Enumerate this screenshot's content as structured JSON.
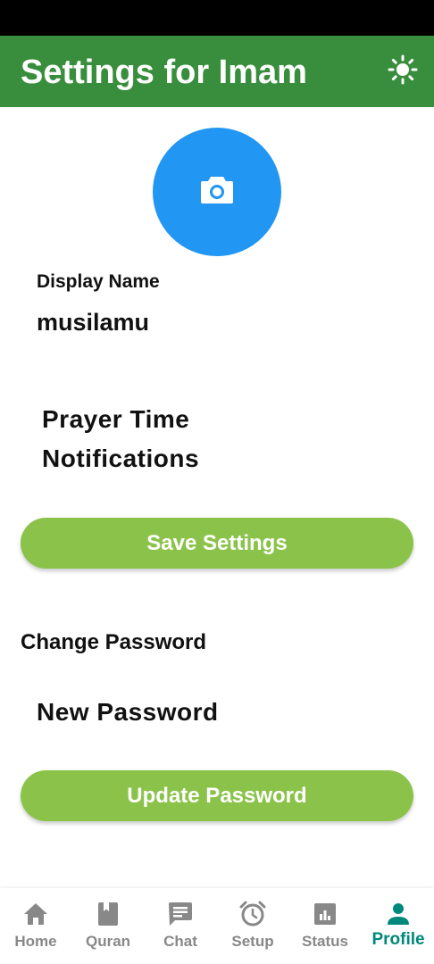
{
  "app_bar": {
    "title": "Settings for Imam",
    "theme_icon": "sun-icon"
  },
  "profile": {
    "avatar_icon": "camera-icon",
    "avatar_color": "#2196f3",
    "display_name_label": "Display Name",
    "display_name_value": "musilamu"
  },
  "notifications": {
    "label": "Prayer Time Notifications"
  },
  "buttons": {
    "save_label": "Save Settings",
    "update_password_label": "Update Password"
  },
  "password": {
    "section_title": "Change Password",
    "new_password_label": "New Password"
  },
  "bottom_nav": {
    "items": [
      {
        "label": "Home",
        "icon": "home-icon"
      },
      {
        "label": "Quran",
        "icon": "book-icon"
      },
      {
        "label": "Chat",
        "icon": "chat-icon"
      },
      {
        "label": "Setup",
        "icon": "alarm-icon"
      },
      {
        "label": "Status",
        "icon": "chart-icon"
      },
      {
        "label": "Profile",
        "icon": "person-icon",
        "active": true
      }
    ]
  },
  "colors": {
    "app_bar": "#388e3c",
    "button": "#8bc34a",
    "active_nav": "#00897b",
    "inactive_nav": "#888888"
  }
}
